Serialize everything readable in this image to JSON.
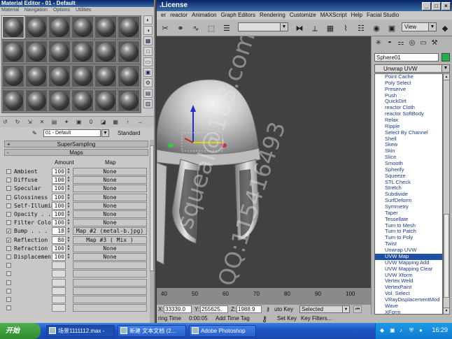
{
  "material_editor": {
    "title": "Material Editor - 01 - Default",
    "menu": [
      "Material",
      "Navigation",
      "Options",
      "Utilities"
    ],
    "material_name": "01 - Default",
    "material_type": "Standard",
    "rollout_supersampling": "SuperSampling",
    "rollout_maps": "Maps",
    "maps_header_amount": "Amount",
    "maps_header_map": "Map",
    "maps": [
      {
        "label": "Ambient",
        "amount": "100",
        "map": "None",
        "checked": false,
        "dim": false
      },
      {
        "label": "Diffuse",
        "amount": "100",
        "map": "None",
        "checked": false,
        "dim": false
      },
      {
        "label": "Specular",
        "amount": "100",
        "map": "None",
        "checked": false,
        "dim": false
      },
      {
        "label": "Glossiness",
        "amount": "100",
        "map": "None",
        "checked": false,
        "dim": false
      },
      {
        "label": "Self-Illumin",
        "amount": "100",
        "map": "None",
        "checked": false,
        "dim": false
      },
      {
        "label": "Opacity . .",
        "amount": "100",
        "map": "None",
        "checked": false,
        "dim": false
      },
      {
        "label": "Filter Color",
        "amount": "100",
        "map": "None",
        "checked": false,
        "dim": false
      },
      {
        "label": "Bump . . .",
        "amount": "18",
        "map": "Map #2 (metal-b.jpg)",
        "checked": true,
        "dim": false
      },
      {
        "label": "Reflection",
        "amount": "80",
        "map": "Map #3 ( Mix )",
        "checked": true,
        "dim": false
      },
      {
        "label": "Refraction",
        "amount": "100",
        "map": "None",
        "checked": false,
        "dim": false
      },
      {
        "label": "Displacement",
        "amount": "100",
        "map": "None",
        "checked": false,
        "dim": false
      }
    ]
  },
  "max": {
    "title": ".License",
    "menu": [
      "er",
      "reactor",
      "Animation",
      "Graph Editors",
      "Rendering",
      "Customize",
      "MAXScript",
      "Help",
      "Facial Studio"
    ],
    "view_label": "View"
  },
  "command_panel": {
    "object_name": "Sphere01",
    "modifier_list": "Unwrap UVW",
    "modifiers": [
      "Point Cache",
      "Poly Select",
      "Preserve",
      "Push",
      "QuickDirt",
      "reactor Cloth",
      "reactor SoftBody",
      "Relax",
      "Ripple",
      "Select By Channel",
      "Shell",
      "Skew",
      "Skin",
      "Slice",
      "Smooth",
      "Spherify",
      "Squeeze",
      "STL Check",
      "Stretch",
      "Subdivide",
      "SurfDeform",
      "Symmetry",
      "Taper",
      "Tessellate",
      "Turn to Mesh",
      "Turn to Patch",
      "Turn to Poly",
      "Twist",
      "Unwrap UVW",
      "UVW Map",
      "UVW Mapping Add",
      "UVW Mapping Clear",
      "UVW Xform",
      "Vertex Weld",
      "VertexPaint",
      "Vol. Select",
      "VRayDisplacementMod",
      "Wave",
      "XForm"
    ],
    "selected_modifier": "UVW Map"
  },
  "timeline": {
    "ticks": [
      "40",
      "50",
      "60",
      "70",
      "80",
      "90",
      "100"
    ]
  },
  "status": {
    "x_label": "X:",
    "x_value": "33339.0",
    "y_label": "Y:",
    "y_value": "255625.",
    "z_label": "Z:",
    "z_value": "1988.9",
    "auto_key": "uto Key",
    "selected": "Selected",
    "set_key": "Set Key",
    "key_filters": "Key Filters...",
    "rendering_time_label": "ring Time",
    "rendering_time": "0:00:05",
    "add_time_tag": "Add Time Tag"
  },
  "watermark": {
    "line1": "squeal@163.com",
    "line2": "QQ:115416493"
  },
  "taskbar": {
    "start": "开始",
    "tasks": [
      "场景1111112.max -",
      "新建 文本文档 (2...",
      "Adobe Photoshop"
    ],
    "time": "16:29"
  }
}
